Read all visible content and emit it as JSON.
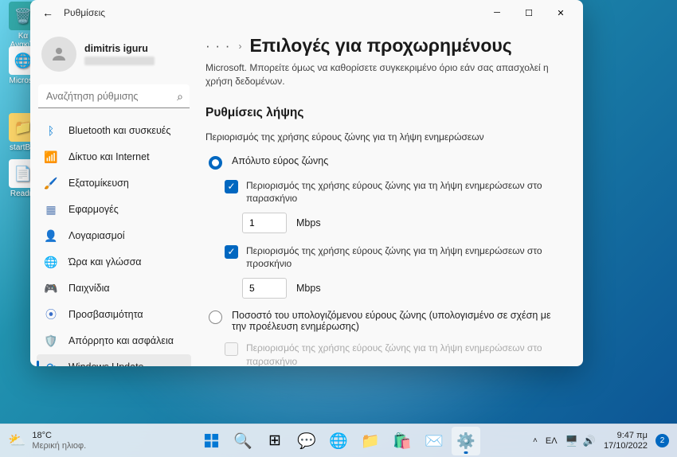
{
  "desktop": {
    "icons": [
      {
        "label": "Κα",
        "sub": "Ανακύκ"
      },
      {
        "label": "Microso"
      },
      {
        "label": "startBlu"
      },
      {
        "label": "Readm"
      }
    ]
  },
  "window": {
    "title": "Ρυθμίσεις",
    "user": {
      "name": "dimitris iguru"
    },
    "search_placeholder": "Αναζήτηση ρύθμισης",
    "nav": [
      {
        "label": "Bluetooth και συσκευές",
        "icon": "bluetooth"
      },
      {
        "label": "Δίκτυο και Internet",
        "icon": "wifi"
      },
      {
        "label": "Εξατομίκευση",
        "icon": "personalize"
      },
      {
        "label": "Εφαρμογές",
        "icon": "apps"
      },
      {
        "label": "Λογαριασμοί",
        "icon": "accounts"
      },
      {
        "label": "Ώρα και γλώσσα",
        "icon": "time"
      },
      {
        "label": "Παιχνίδια",
        "icon": "gaming"
      },
      {
        "label": "Προσβασιμότητα",
        "icon": "accessibility"
      },
      {
        "label": "Απόρρητο και ασφάλεια",
        "icon": "privacy"
      },
      {
        "label": "Windows Update",
        "icon": "update",
        "active": true
      }
    ]
  },
  "content": {
    "breadcrumb_dots": "· · ·",
    "heading": "Επιλογές για προχωρημένους",
    "description": "Microsoft. Μπορείτε όμως να καθορίσετε συγκεκριμένο όριο εάν σας απασχολεί η χρήση δεδομένων.",
    "section_title": "Ρυθμίσεις λήψης",
    "section_desc": "Περιορισμός της χρήσης εύρους ζώνης για τη λήψη ενημερώσεων",
    "radio_absolute": "Απόλυτο εύρος ζώνης",
    "check_background": "Περιορισμός της χρήσης εύρους ζώνης για τη λήψη ενημερώσεων στο παρασκήνιο",
    "bg_value": "1",
    "check_foreground": "Περιορισμός της χρήσης εύρους ζώνης για τη λήψη ενημερώσεων στο προσκήνιο",
    "fg_value": "5",
    "mbps": "Mbps",
    "radio_percent": "Ποσοστό του υπολογιζόμενου εύρους ζώνης (υπολογισμένο σε σχέση με την προέλευση ενημέρωσης)",
    "check_disabled": "Περιορισμός της χρήσης εύρους ζώνης για τη λήψη ενημερώσεων στο παρασκήνιο"
  },
  "taskbar": {
    "weather": {
      "temp": "18°C",
      "cond": "Μερική ηλιοφ."
    },
    "lang": "ΕΛ",
    "time": "9:47 πμ",
    "date": "17/10/2022",
    "notif_count": "2"
  }
}
